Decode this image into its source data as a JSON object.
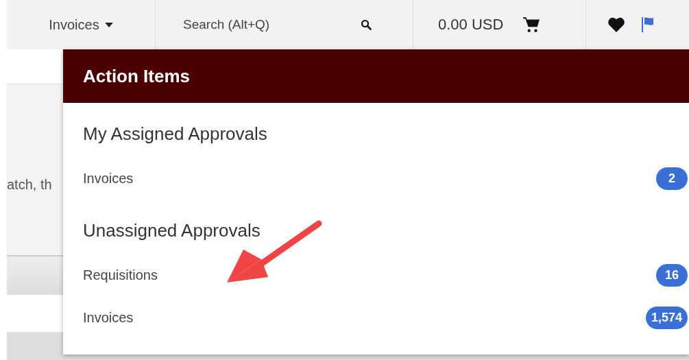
{
  "toolbar": {
    "menu": {
      "label": "Invoices"
    },
    "search": {
      "placeholder": "Search (Alt+Q)"
    },
    "cart_total": "0.00 USD"
  },
  "background": {
    "text_fragment": "atch, th"
  },
  "action_items": {
    "title": "Action Items",
    "sections": [
      {
        "heading": "My Assigned Approvals",
        "items": [
          {
            "label": "Invoices",
            "count": "2"
          }
        ]
      },
      {
        "heading": "Unassigned Approvals",
        "items": [
          {
            "label": "Requisitions",
            "count": "16"
          },
          {
            "label": "Invoices",
            "count": "1,574"
          }
        ]
      }
    ]
  }
}
